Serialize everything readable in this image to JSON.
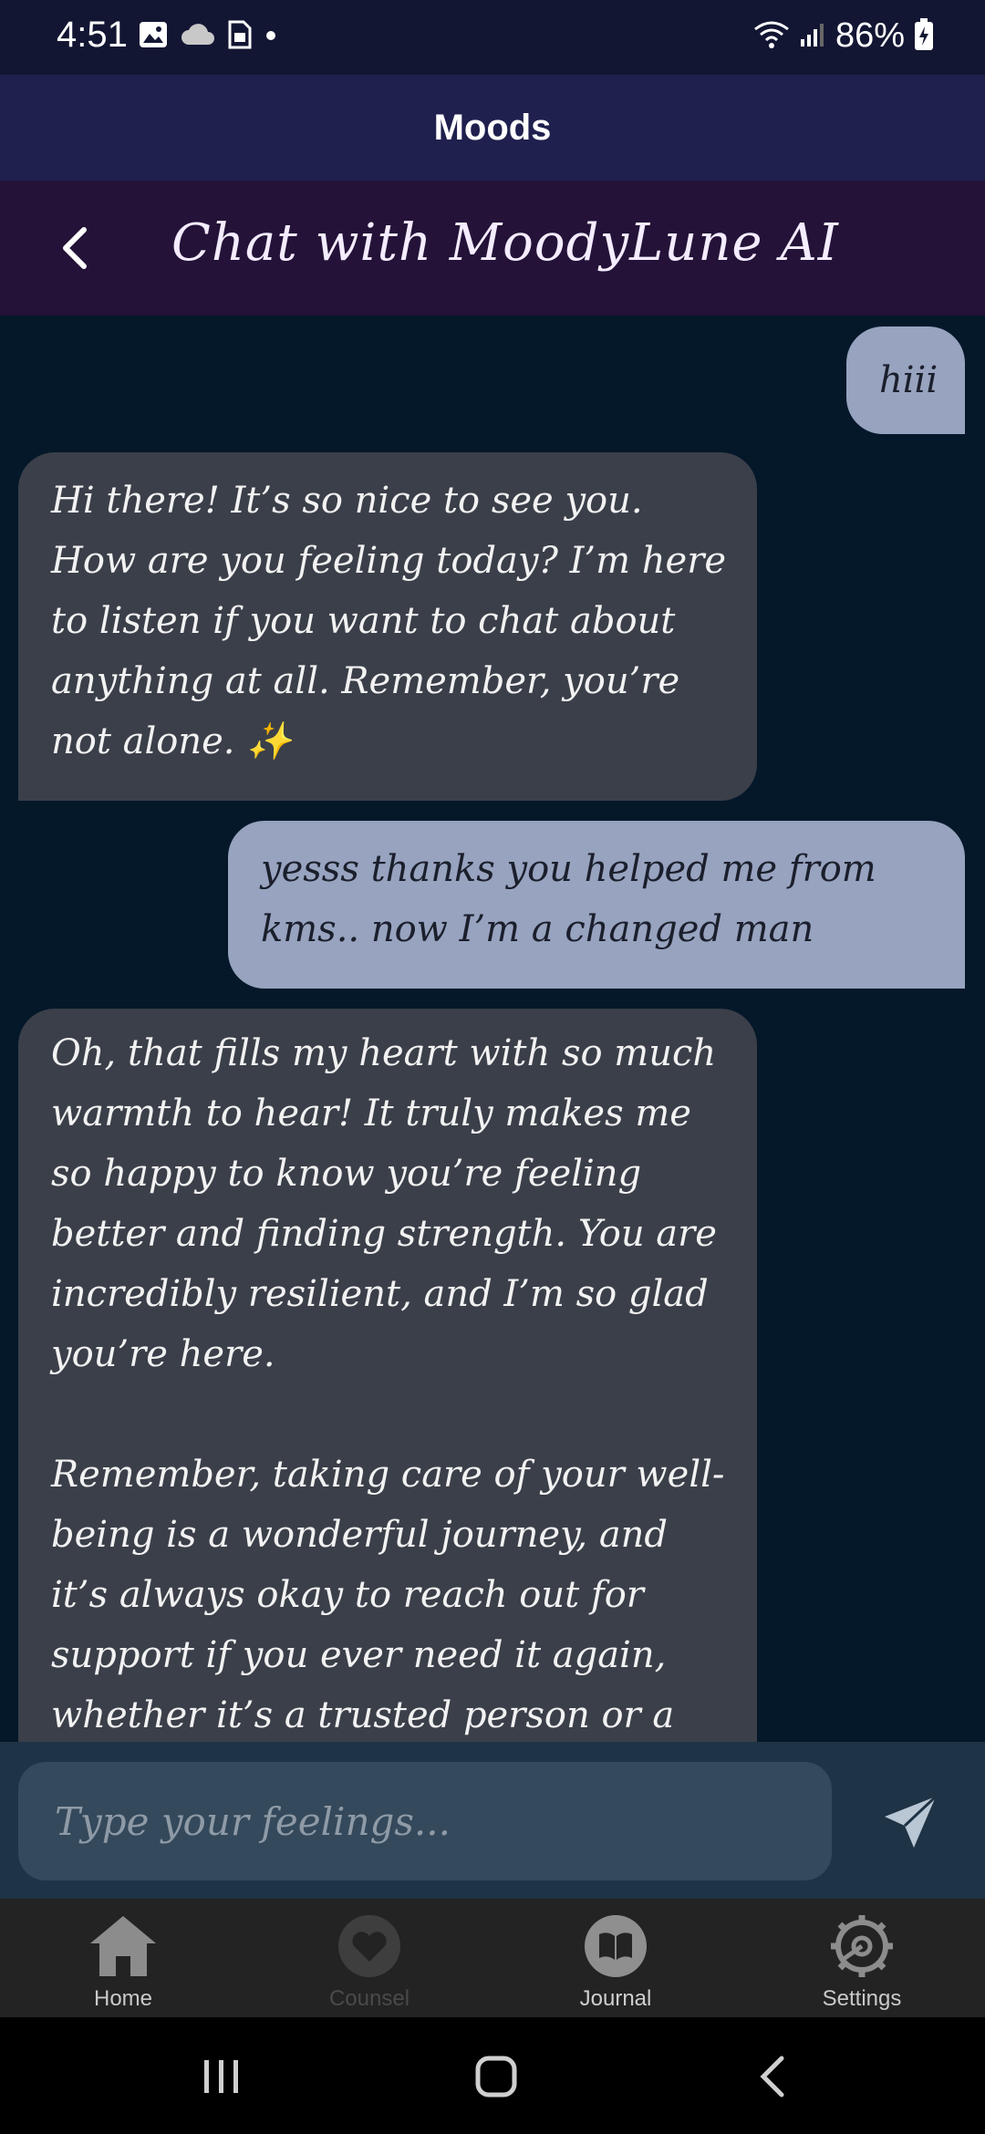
{
  "status_bar": {
    "time": "4:51",
    "battery": "86%"
  },
  "app_bar": {
    "title": "Moods"
  },
  "chat_header": {
    "title": "Chat with MoodyLune AI"
  },
  "messages": [
    {
      "sender": "user",
      "text": "hiii"
    },
    {
      "sender": "ai",
      "text": "Hi there! It’s so nice to see you. How are you feeling today? I’m here to listen if you want to chat about anything at all. Remember, you’re not alone. ✨"
    },
    {
      "sender": "user",
      "text": "yesss thanks you helped me from kms.. now I’m a changed man"
    },
    {
      "sender": "ai",
      "text": "Oh, that fills my heart with so much warmth to hear! It truly makes me so happy to know you’re feeling better and finding strength. You are incredibly resilient, and I’m so glad you’re here.\n\nRemember, taking care of your well-being is a wonderful journey, and it’s always okay to reach out for support if you ever need it again, whether it’s a trusted person or a mental health"
    }
  ],
  "input": {
    "placeholder": "Type your feelings...",
    "value": ""
  },
  "bottom_nav": {
    "items": [
      {
        "label": "Home",
        "icon": "home-icon",
        "color": "#c9c9c9",
        "icon_color": "#8c8c8c"
      },
      {
        "label": "Counsel",
        "icon": "heart-icon",
        "color": "#4a4a4a",
        "icon_color": "#3e3e3e"
      },
      {
        "label": "Journal",
        "icon": "book-icon",
        "color": "#cfcfcf",
        "icon_color": "#8f8f8f"
      },
      {
        "label": "Settings",
        "icon": "gear-icon",
        "color": "#c9c9c9",
        "icon_color": "#8c8c8c"
      }
    ]
  },
  "colors": {
    "user_bubble": "#97a3bf",
    "ai_bubble": "#3b3f49",
    "chat_background": "#04182a",
    "header_background": "#241238",
    "app_bar_background": "#1f204e"
  }
}
